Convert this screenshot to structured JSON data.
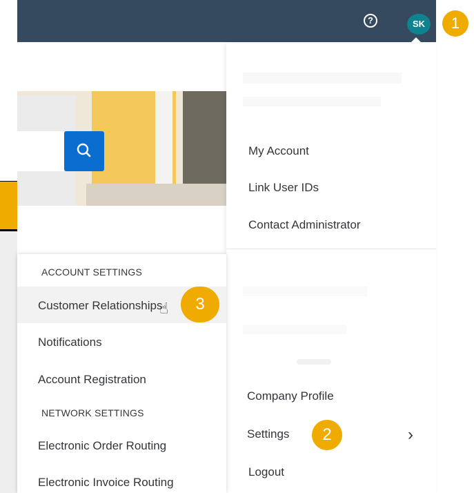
{
  "shellbar": {
    "help_icon": "question-circle-icon",
    "help_glyph": "?",
    "avatar_initials": "SK",
    "colors": {
      "bar": "#354a5f",
      "avatar": "#0f828f",
      "marker": "#f0ab00",
      "search": "#0a6ed1"
    }
  },
  "step_markers": [
    "1",
    "2",
    "3"
  ],
  "search": {
    "button_icon": "search-icon"
  },
  "user_menu": {
    "items": [
      {
        "label": "My Account"
      },
      {
        "label": "Link User IDs"
      },
      {
        "label": "Contact Administrator"
      }
    ],
    "bottom_items": [
      {
        "label": "Company Profile"
      },
      {
        "label": "Settings",
        "icon": "chevron-right-icon",
        "glyph": "›"
      },
      {
        "label": "Logout"
      }
    ]
  },
  "settings_submenu": {
    "account_header": "ACCOUNT SETTINGS",
    "account_items": [
      {
        "label": "Customer Relationships"
      },
      {
        "label": "Notifications"
      },
      {
        "label": "Account Registration"
      }
    ],
    "network_header": "NETWORK SETTINGS",
    "network_items": [
      {
        "label": "Electronic Order Routing"
      },
      {
        "label": "Electronic Invoice Routing"
      }
    ],
    "cursor_icon": "hand-pointer-icon",
    "cursor_glyph": "☝"
  }
}
